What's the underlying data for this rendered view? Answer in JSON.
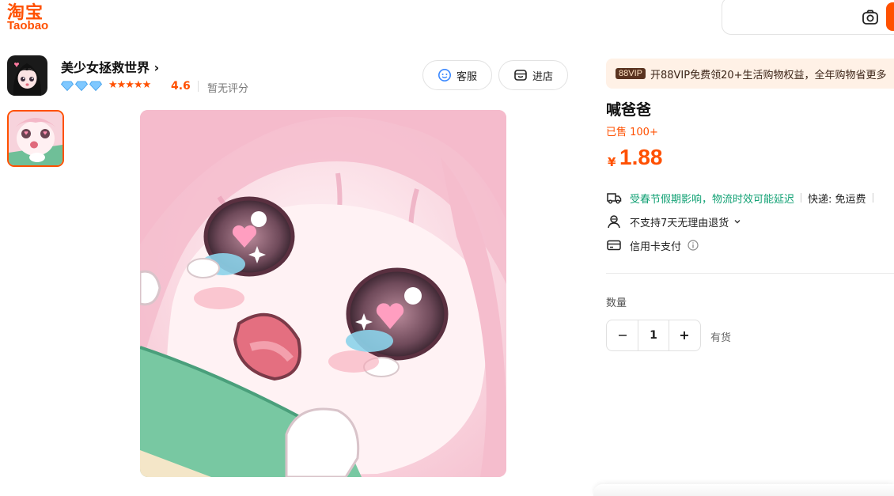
{
  "logo": {
    "cn": "淘宝",
    "en": "Taobao"
  },
  "search": {
    "camera_icon": "camera-icon"
  },
  "shop": {
    "name": "美少女拯救世界",
    "chevron": "›",
    "rating": "4.6",
    "no_rating": "暂无评分",
    "service_label": "客服",
    "store_label": "进店"
  },
  "vip": {
    "badge": "88VIP",
    "text": "开88VIP免费领20+生活购物权益，全年购物省更多"
  },
  "product": {
    "title": "喊爸爸",
    "sold": "已售 100+",
    "currency": "¥",
    "price": "1.88",
    "shipping_notice": "受春节假期影响，物流时效可能延迟",
    "shipping_fee": "快递: 免运费",
    "returns": "不支持7天无理由退货",
    "payment": "信用卡支付",
    "quantity_label": "数量",
    "quantity": "1",
    "stock": "有货"
  },
  "colors": {
    "brand": "#ff5000",
    "notice_green": "#12a174",
    "vip_bg": "#fff1e6"
  }
}
